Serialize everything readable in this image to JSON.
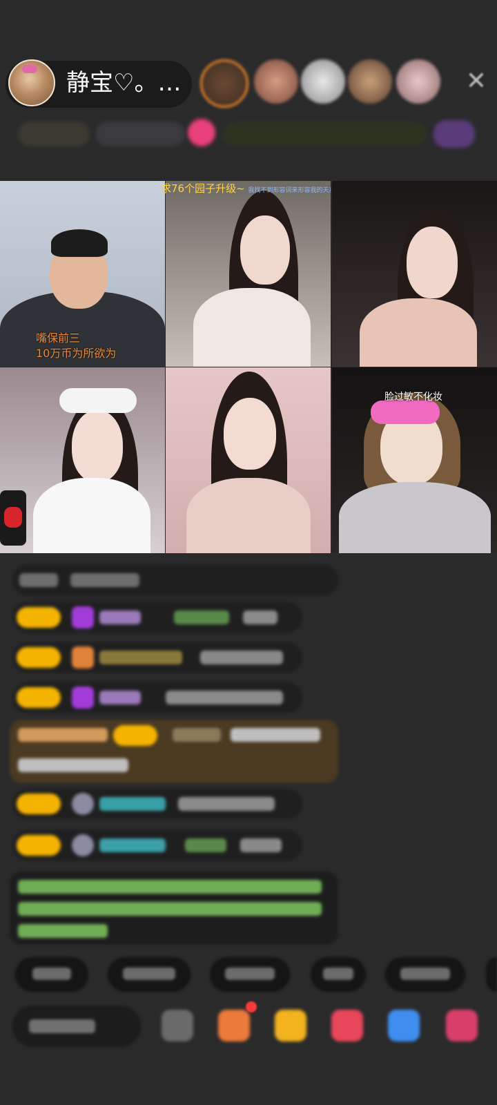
{
  "host": {
    "name": "静宝♡。…",
    "avatar_icon": "hamster-avatar-icon"
  },
  "header": {
    "close_icon": "close-icon",
    "close_glyph": "✕"
  },
  "grid": {
    "banner_text": "求76个园子升级~",
    "banner_small": "我找不到形容词来形容我的天真",
    "tile1_caption_line1": "嘴保前三",
    "tile1_caption_line2": "10万币为所欲为",
    "tile6_caption": "脸过敏不化妆"
  },
  "colors": {
    "background": "#2a2a2b",
    "badge": "#f4b400",
    "caption_orange": "#f08a2a",
    "banner_yellow": "#ffd24a",
    "highlight_row": "#4b3a22",
    "green_text": "#8fd46a"
  }
}
